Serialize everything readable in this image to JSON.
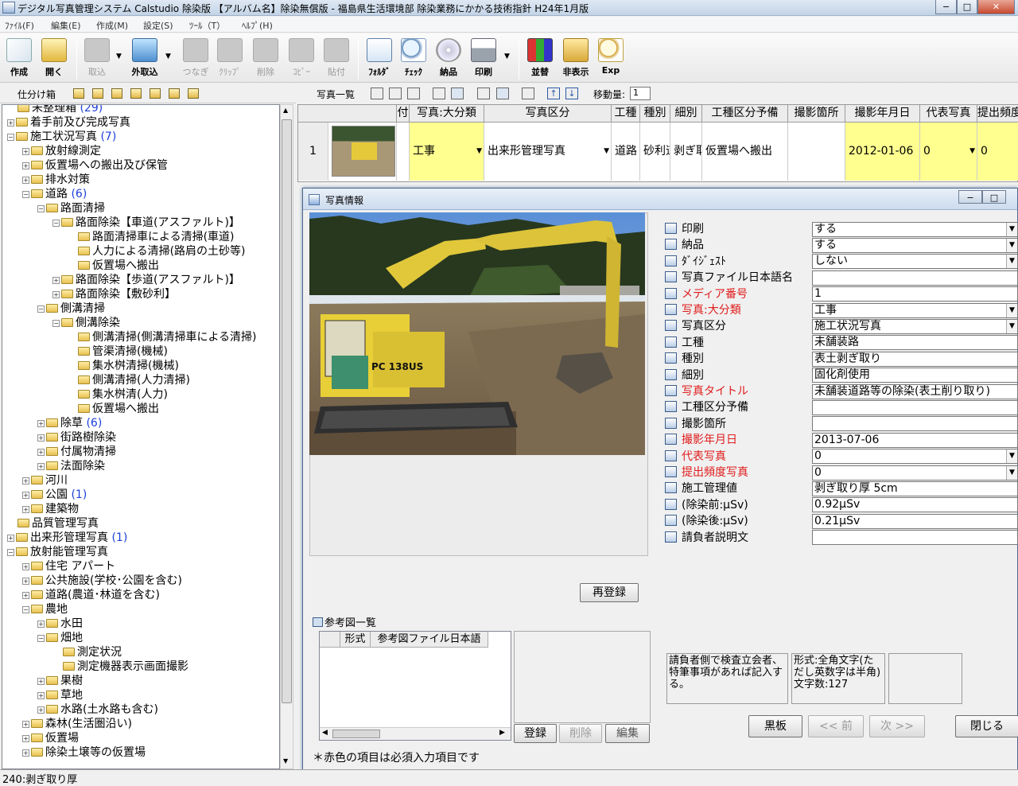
{
  "window": {
    "title": "デジタル写真管理システム Calstudio 除染版 【アルバム名】除染無償版 - 福島県生活環境部 除染業務にかかる技術指針 H24年1月版",
    "controls": [
      "−",
      "□",
      "✕"
    ]
  },
  "menu": [
    "ﾌｧｲﾙ(F)",
    "編集(E)",
    "作成(M)",
    "設定(S)",
    "ﾂｰﾙ（T）",
    "ﾍﾙﾌﾟ(H)"
  ],
  "toolbar": {
    "create": "作成",
    "open": "開く",
    "import": "取込",
    "ext_import": "外取込",
    "connect": "つなぎ",
    "clip": "ｸﾘｯﾌﾟ",
    "delete": "削除",
    "copy": "ｺﾋﾟｰ",
    "paste": "貼付",
    "folder": "ﾌｫﾙﾀﾞ",
    "check": "ﾁｪｯｸ",
    "deliver": "納品",
    "print": "印刷",
    "sort": "並替",
    "hide": "非表示",
    "exp": "Exp"
  },
  "left_panel": {
    "label": "仕分け箱"
  },
  "tree": [
    {
      "label": "未整理箱",
      "count": "(29)"
    },
    {
      "label": "着手前及び完成写真"
    },
    {
      "label": "施工状況写真",
      "count": "(7)"
    },
    {
      "label": "放射線測定"
    },
    {
      "label": "仮置場への搬出及び保管"
    },
    {
      "label": "排水対策"
    },
    {
      "label": "道路",
      "count": "(6)"
    },
    {
      "label": "路面清掃"
    },
    {
      "label": "路面除染【車道(アスファルト)】"
    },
    {
      "label": "路面清掃車による清掃(車道)"
    },
    {
      "label": "人力による清掃(路肩の土砂等)"
    },
    {
      "label": "仮置場へ搬出"
    },
    {
      "label": "路面除染【歩道(アスファルト)】"
    },
    {
      "label": "路面除染【敷砂利】"
    },
    {
      "label": "側溝清掃"
    },
    {
      "label": "側溝除染"
    },
    {
      "label": "側溝清掃(側溝清掃車による清掃)"
    },
    {
      "label": "管渠清掃(機械)"
    },
    {
      "label": "集水桝清掃(機械)"
    },
    {
      "label": "側溝清掃(人力清掃)"
    },
    {
      "label": "集水桝清(人力)"
    },
    {
      "label": "仮置場へ搬出"
    },
    {
      "label": "除草",
      "count": "(6)"
    },
    {
      "label": "街路樹除染"
    },
    {
      "label": "付属物清掃"
    },
    {
      "label": "法面除染"
    },
    {
      "label": "河川"
    },
    {
      "label": "公園",
      "count": "(1)"
    },
    {
      "label": "建築物"
    },
    {
      "label": "品質管理写真"
    },
    {
      "label": "出来形管理写真",
      "count": "(1)"
    },
    {
      "label": "放射能管理写真"
    },
    {
      "label": "住宅 アパート"
    },
    {
      "label": "公共施設(学校･公園を含む)"
    },
    {
      "label": "道路(農道･林道を含む)"
    },
    {
      "label": "農地"
    },
    {
      "label": "水田"
    },
    {
      "label": "畑地"
    },
    {
      "label": "測定状況"
    },
    {
      "label": "測定機器表示画面撮影"
    },
    {
      "label": "果樹"
    },
    {
      "label": "草地"
    },
    {
      "label": "水路(土水路も含む)"
    },
    {
      "label": "森林(生活圏沿い)"
    },
    {
      "label": "仮置場"
    },
    {
      "label": "除染土壌等の仮置場"
    }
  ],
  "right_toolbar": {
    "list_label": "写真一覧",
    "move_label": "移動量:",
    "move_value": "1"
  },
  "grid": {
    "headers": [
      "付",
      "写真:大分類",
      "写真区分",
      "工種",
      "種別",
      "細別",
      "工種区分予備",
      "撮影箇所",
      "撮影年月日",
      "代表写真",
      "提出頻度"
    ],
    "row": {
      "no": "1",
      "major": "工事",
      "category": "出来形管理写真",
      "work": "道路",
      "type": "砂利道",
      "sub": "剥ぎ取",
      "reserve": "仮置場へ搬出",
      "place": "",
      "date": "2012-01-06",
      "rep": "0",
      "freq": "0"
    }
  },
  "dialog": {
    "title": "写真情報",
    "fields": [
      {
        "label": "印刷",
        "value": "する",
        "dropdown": true,
        "required": false
      },
      {
        "label": "納品",
        "value": "する",
        "dropdown": true,
        "required": false
      },
      {
        "label": "ﾀﾞｲｼﾞｪｽﾄ",
        "value": "しない",
        "dropdown": true,
        "required": false
      },
      {
        "label": "写真ファイル日本語名",
        "value": "",
        "dropdown": false,
        "required": false
      },
      {
        "label": "メディア番号",
        "value": "1",
        "dropdown": false,
        "required": true
      },
      {
        "label": "写真:大分類",
        "value": "工事",
        "dropdown": true,
        "required": true
      },
      {
        "label": "写真区分",
        "value": "施工状況写真",
        "dropdown": true,
        "required": false
      },
      {
        "label": "工種",
        "value": "未舗装路",
        "dropdown": false,
        "required": false
      },
      {
        "label": "種別",
        "value": "表土剥ぎ取り",
        "dropdown": false,
        "required": false
      },
      {
        "label": "細別",
        "value": "固化剤使用",
        "dropdown": false,
        "required": false
      },
      {
        "label": "写真タイトル",
        "value": "未舗装道路等の除染(表土削り取り)",
        "dropdown": false,
        "required": true
      },
      {
        "label": "工種区分予備",
        "value": "",
        "dropdown": false,
        "required": false
      },
      {
        "label": "撮影箇所",
        "value": "",
        "dropdown": false,
        "required": false
      },
      {
        "label": "撮影年月日",
        "value": "2013-07-06",
        "dropdown": false,
        "required": true
      },
      {
        "label": "代表写真",
        "value": "0",
        "dropdown": true,
        "required": true
      },
      {
        "label": "提出頻度写真",
        "value": "0",
        "dropdown": true,
        "required": true
      },
      {
        "label": "施工管理値",
        "value": "剥ぎ取り厚 5cm",
        "dropdown": false,
        "required": false
      },
      {
        "label": "(除染前:μSv)",
        "value": "0.92μSv",
        "dropdown": false,
        "required": false
      },
      {
        "label": "(除染後:μSv)",
        "value": "0.21μSv",
        "dropdown": false,
        "required": false
      },
      {
        "label": "請負者説明文",
        "value": "",
        "dropdown": false,
        "required": false
      }
    ],
    "reregister": "再登録",
    "ref_heading": "参考図一覧",
    "ref_cols": [
      "形式",
      "参考図ファイル日本語"
    ],
    "ref_buttons": {
      "register": "登録",
      "delete": "削除",
      "edit": "編集"
    },
    "note1": "請負者側で検査立会者、特筆事項があれば記入する。",
    "note2": "形式:全角文字(ただし英数字は半角)\n文字数:127",
    "nav": {
      "blackboard": "黒板",
      "prev": "<< 前",
      "next": "次 >>",
      "close": "閉じる"
    },
    "required_note": "＊赤色の項目は必須入力項目です",
    "photo_marking": "PC 138US"
  },
  "status": "240:剥ぎ取り厚",
  "colors": {
    "accent_yellow": "#ffff90",
    "required_red": "#e01c1c",
    "count_blue": "#1c3fd8"
  }
}
